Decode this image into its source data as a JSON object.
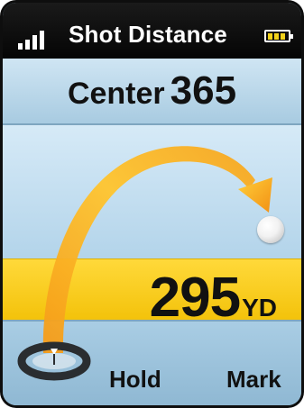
{
  "header": {
    "title": "Shot Distance",
    "signal_icon": "signal-bars-icon",
    "battery_icon": "battery-icon"
  },
  "center": {
    "label": "Center",
    "value": "365"
  },
  "shot": {
    "value": "295",
    "unit": "YD"
  },
  "softkeys": {
    "hold": "Hold",
    "mark": "Mark"
  },
  "colors": {
    "arc_start": "#f7a51f",
    "arc_end": "#ffd540",
    "yard_bar": "#ffd21e",
    "screen_bg": "#a9cde4"
  }
}
